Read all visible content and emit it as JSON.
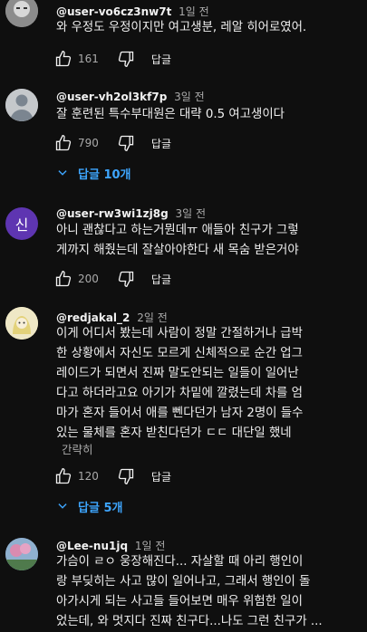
{
  "comments": [
    {
      "author": "@user-vo6cz3nw7t",
      "time": "1일 전",
      "lines": [
        "와 우정도 우정이지만 여고생분, 레알 히어로였어."
      ],
      "likes": "161",
      "reply_label": "답글"
    },
    {
      "author": "@user-vh2ol3kf7p",
      "time": "3일 전",
      "lines": [
        "잘 훈련된 특수부대원은 대략 0.5 여고생이다"
      ],
      "likes": "790",
      "reply_label": "답글",
      "replies_label": "답글 10개"
    },
    {
      "author": "@user-rw3wi1zj8g",
      "time": "3일 전",
      "avatar_letter": "신",
      "lines": [
        "아니 괜찮다고 하는거뭔데ㅠ 애들아 친구가 그렇",
        "게까지 해줬는데 잘살아야한다 새 목숨 받은거야"
      ],
      "likes": "200",
      "reply_label": "답글"
    },
    {
      "author": "@redjakal_2",
      "time": "2일 전",
      "lines": [
        "이게 어디서 봤는데 사람이 정말 간절하거나 급박",
        "한 상황에서 자신도 모르게 신체적으로 순간 업그",
        "레이드가 되면서 진짜 말도안되는 일들이 일어난",
        "다고 하더라고요 아기가 차밑에 깔렸는데 차를 엄",
        "마가 혼자 들어서 애를 뻰다던가 남자 2명이 들수",
        "있는 물체를 혼자 받친다던가 ㄷㄷ 대단일 했네"
      ],
      "read_more": "간략히",
      "likes": "120",
      "reply_label": "답글",
      "replies_label": "답글 5개"
    },
    {
      "author": "@Lee-nu1jq",
      "time": "1일 전",
      "lines": [
        "가슴이 ㄹㅇ 웅장해진다... 자살할 때 아리 행인이",
        "랑 부딪히는 사고 많이 일어나고, 그래서 행인이 돌",
        "아가시게 되는 사고들 들어보면 매우 위험한 일이",
        "었는데, 와 멋지다 진짜 친구다...나도 그런 친구가 ..."
      ]
    }
  ],
  "colors": {
    "background": "#0f0f0f",
    "text": "#f1f1f1",
    "secondary": "#aaaaaa",
    "link": "#3ea6ff",
    "avatar_purple": "#5e35b1"
  }
}
